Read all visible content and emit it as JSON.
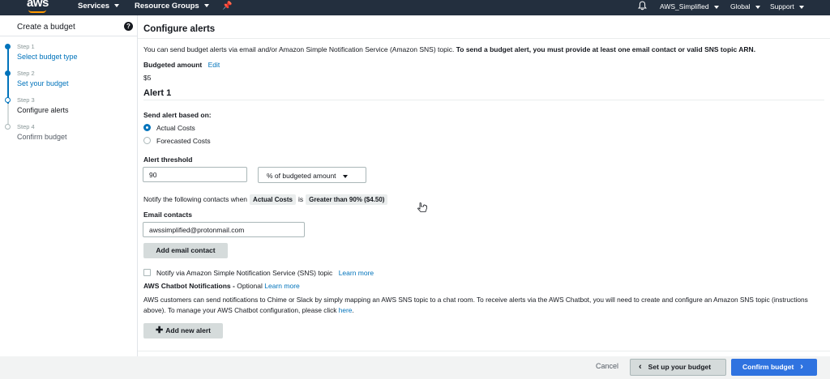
{
  "topnav": {
    "logo": "aws",
    "services": "Services",
    "resource_groups": "Resource Groups",
    "account": "AWS_Simplified",
    "region": "Global",
    "support": "Support"
  },
  "sidebar": {
    "title": "Create a budget",
    "steps": [
      {
        "num": "Step 1",
        "label": "Select budget type"
      },
      {
        "num": "Step 2",
        "label": "Set your budget"
      },
      {
        "num": "Step 3",
        "label": "Configure alerts"
      },
      {
        "num": "Step 4",
        "label": "Confirm budget"
      }
    ]
  },
  "main": {
    "heading": "Configure alerts",
    "intro_plain": "You can send budget alerts via email and/or Amazon Simple Notification Service (Amazon SNS) topic.",
    "intro_bold": "To send a budget alert, you must provide at least one email contact or valid SNS topic ARN.",
    "budgeted_amount_label": "Budgeted amount",
    "edit_link": "Edit",
    "budgeted_amount_value": "$5",
    "alert_title": "Alert 1",
    "send_alert_label": "Send alert based on:",
    "radio_actual": "Actual Costs",
    "radio_forecasted": "Forecasted Costs",
    "threshold_label": "Alert threshold",
    "threshold_value": "90",
    "threshold_unit": "% of budgeted amount",
    "notify_prefix": "Notify the following contacts when",
    "notify_pill_1": "Actual Costs",
    "notify_is": "is",
    "notify_pill_2": "Greater than 90% ($4.50)",
    "email_contacts_label": "Email contacts",
    "email_value": "awssimplified@protonmail.com",
    "add_email_button": "Add email contact",
    "sns_checkbox_label": "Notify via Amazon Simple Notification Service (SNS) topic",
    "sns_learn_more": "Learn more",
    "chatbot_title": "AWS Chatbot Notifications -",
    "chatbot_optional": "Optional",
    "chatbot_learn_more": "Learn more",
    "chatbot_desc": "AWS customers can send notifications to Chime or Slack by simply mapping an AWS SNS topic to a chat room. To receive alerts via the AWS Chatbot, you will need to create and configure an Amazon SNS topic (instructions above). To manage your AWS Chatbot configuration, please click",
    "chatbot_here": "here",
    "chatbot_period": ".",
    "add_alert_button": "Add new alert"
  },
  "footer": {
    "cancel": "Cancel",
    "prev_button": "Set up your budget",
    "next_button": "Confirm budget"
  },
  "icons": {
    "pin": "pin-icon",
    "bell": "bell-icon",
    "help": "help-icon",
    "plus": "plus-icon",
    "chevron_left": "chevron-left-icon",
    "chevron_right": "chevron-right-icon"
  },
  "colors": {
    "nav_bg": "#232f3e",
    "link": "#0073bb",
    "primary_button": "#2f73e0",
    "logo_accent": "#ff9900"
  }
}
